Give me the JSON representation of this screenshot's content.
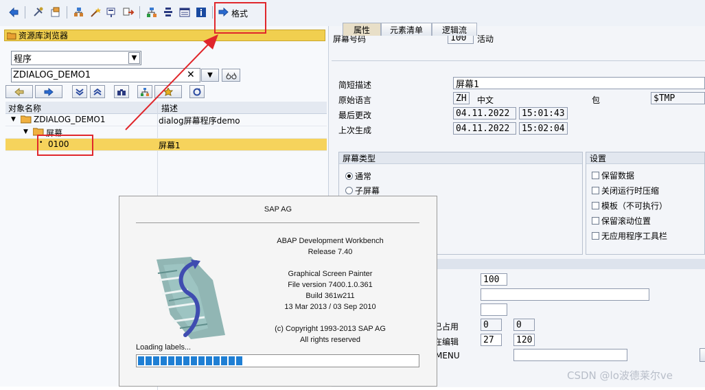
{
  "toolbar": {
    "format_label": "格式",
    "icons": [
      "back-icon",
      "tools-icon",
      "other-object-icon",
      "hierarchy-icon",
      "magic-wand-icon",
      "copy-screen-icon",
      "where-used-icon",
      "layout-icon",
      "flow-logic-icon",
      "element-list-icon",
      "info-icon",
      "format-arrow-icon"
    ]
  },
  "left": {
    "title": "资源库浏览器",
    "object_type": "程序",
    "object_name": "ZDIALOG_DEMO1",
    "tree_header": {
      "col1": "对象名称",
      "col2": "描述"
    },
    "tree": [
      {
        "name": "ZDIALOG_DEMO1",
        "desc": "dialog屏幕程序demo"
      },
      {
        "name": "屏幕",
        "desc": ""
      },
      {
        "name": "0100",
        "desc": "屏幕1"
      }
    ]
  },
  "right": {
    "screen_no_label": "屏幕号码",
    "screen_no": "100",
    "status": "活动",
    "tabs": [
      "属性",
      "元素清单",
      "逻辑流"
    ],
    "fields": {
      "short_desc_label": "简短描述",
      "short_desc": "屏幕1",
      "orig_lang_label": "原始语言",
      "orig_lang": "ZH",
      "orig_lang_text": "中文",
      "package_label": "包",
      "package": "$TMP",
      "last_changed_label": "最后更改",
      "last_changed_date": "04.11.2022",
      "last_changed_time": "15:01:43",
      "last_generated_label": "上次生成",
      "last_generated_date": "04.11.2022",
      "last_generated_time": "15:02:04"
    },
    "screen_type": {
      "title": "屏幕类型",
      "options": [
        "通常",
        "子屏幕"
      ]
    },
    "settings": {
      "title": "设置",
      "options": [
        "保留数据",
        "关闭运行时压缩",
        "模板（不可执行）",
        "保留滚动位置",
        "无应用程序工具栏"
      ]
    },
    "other": {
      "next_screen": "100",
      "occupied_label": "已占用",
      "occupied_a": "0",
      "occupied_b": "0",
      "editing_label": "在编辑",
      "editing_a": "27",
      "editing_b": "120",
      "menu_label": "MENU"
    }
  },
  "splash": {
    "company": "SAP AG",
    "product": "ABAP Development Workbench",
    "release": "Release 7.40",
    "tool": "Graphical Screen Painter",
    "file_version": "File version 7400.1.0.361",
    "build": "Build 361w211",
    "dates": "13 Mar 2013 / 03 Sep 2010",
    "copyright": "(c) Copyright 1993-2013  SAP AG",
    "rights": "All rights reserved",
    "loading": "Loading labels...",
    "progress": 0.38
  },
  "watermark": "CSDN @lo波德莱尔ve",
  "colors": {
    "highlight": "#f6d35c",
    "annotation": "#e0262b",
    "progress": "#1f7fd4"
  }
}
